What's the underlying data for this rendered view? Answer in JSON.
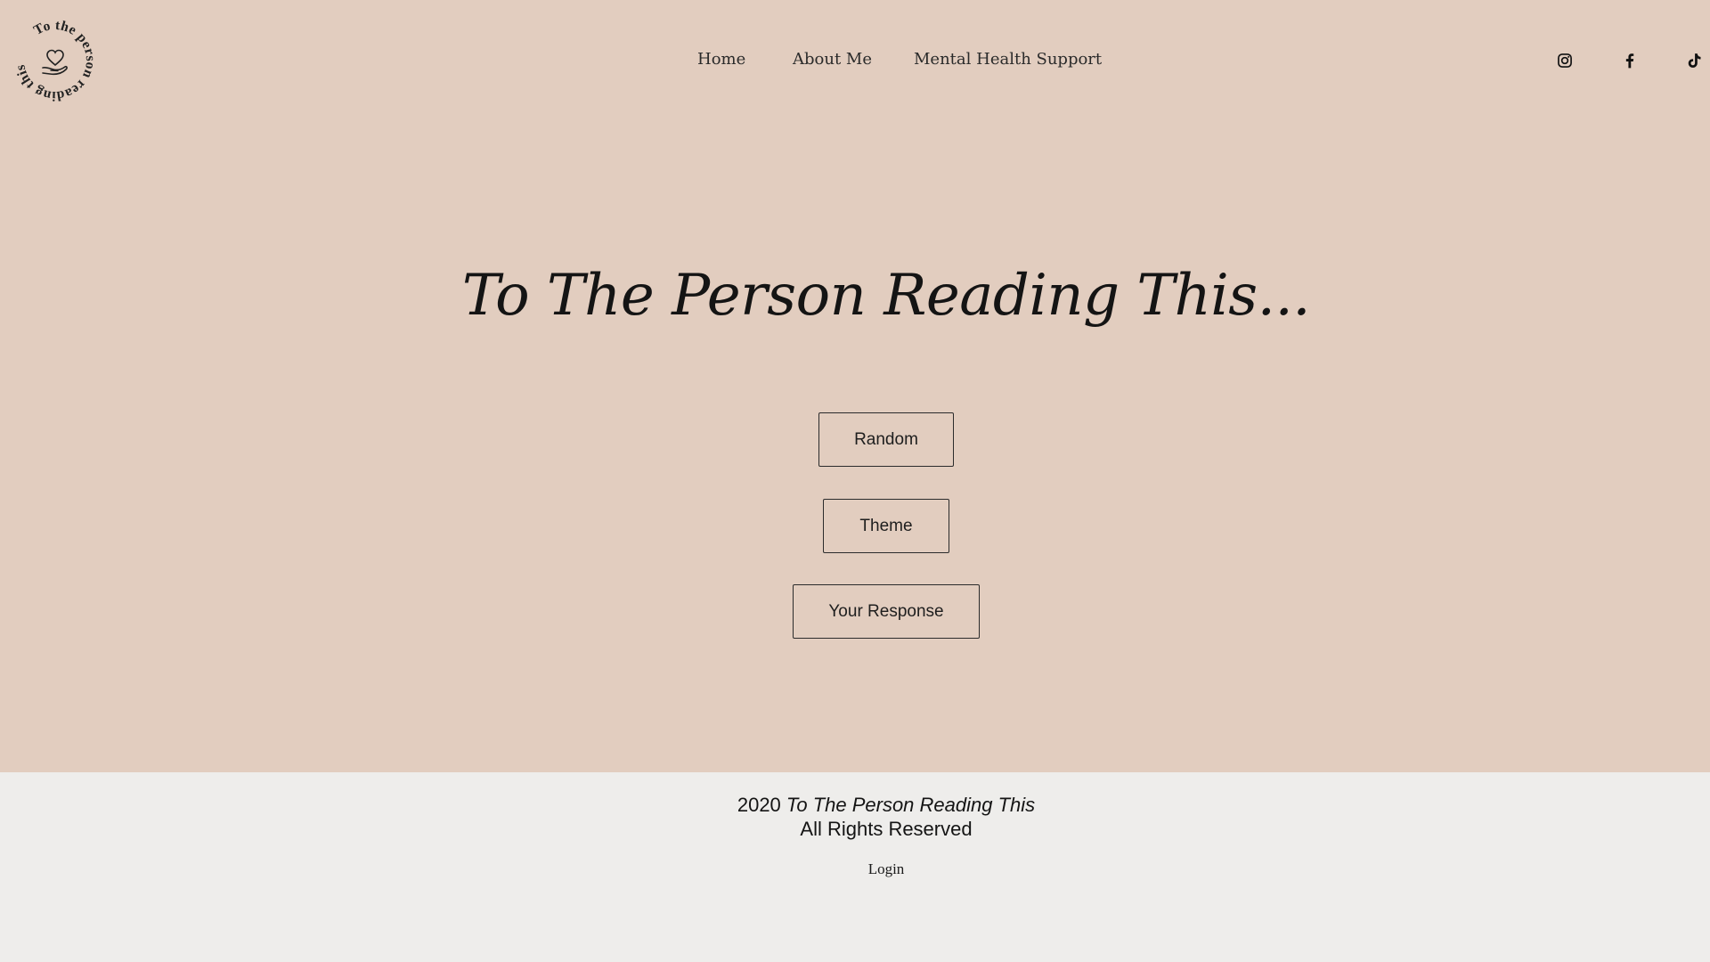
{
  "site": {
    "logo_text": "To the person reading this . . ."
  },
  "nav": {
    "items": [
      {
        "label": "Home"
      },
      {
        "label": "About Me"
      },
      {
        "label": "Mental Health Support"
      }
    ]
  },
  "social": {
    "icons": [
      "instagram-icon",
      "facebook-icon",
      "tiktok-icon"
    ]
  },
  "hero": {
    "title": "To The Person Reading This...",
    "buttons": [
      {
        "label": "Random"
      },
      {
        "label": "Theme"
      },
      {
        "label": "Your Response"
      }
    ]
  },
  "footer": {
    "year": "2020",
    "site_name": "To The Person Reading This",
    "rights": "All Rights Reserved",
    "login_label": "Login"
  },
  "colors": {
    "main_bg": "#e2cdbf",
    "footer_bg": "#eeedeb",
    "text": "#1a1a1a"
  }
}
